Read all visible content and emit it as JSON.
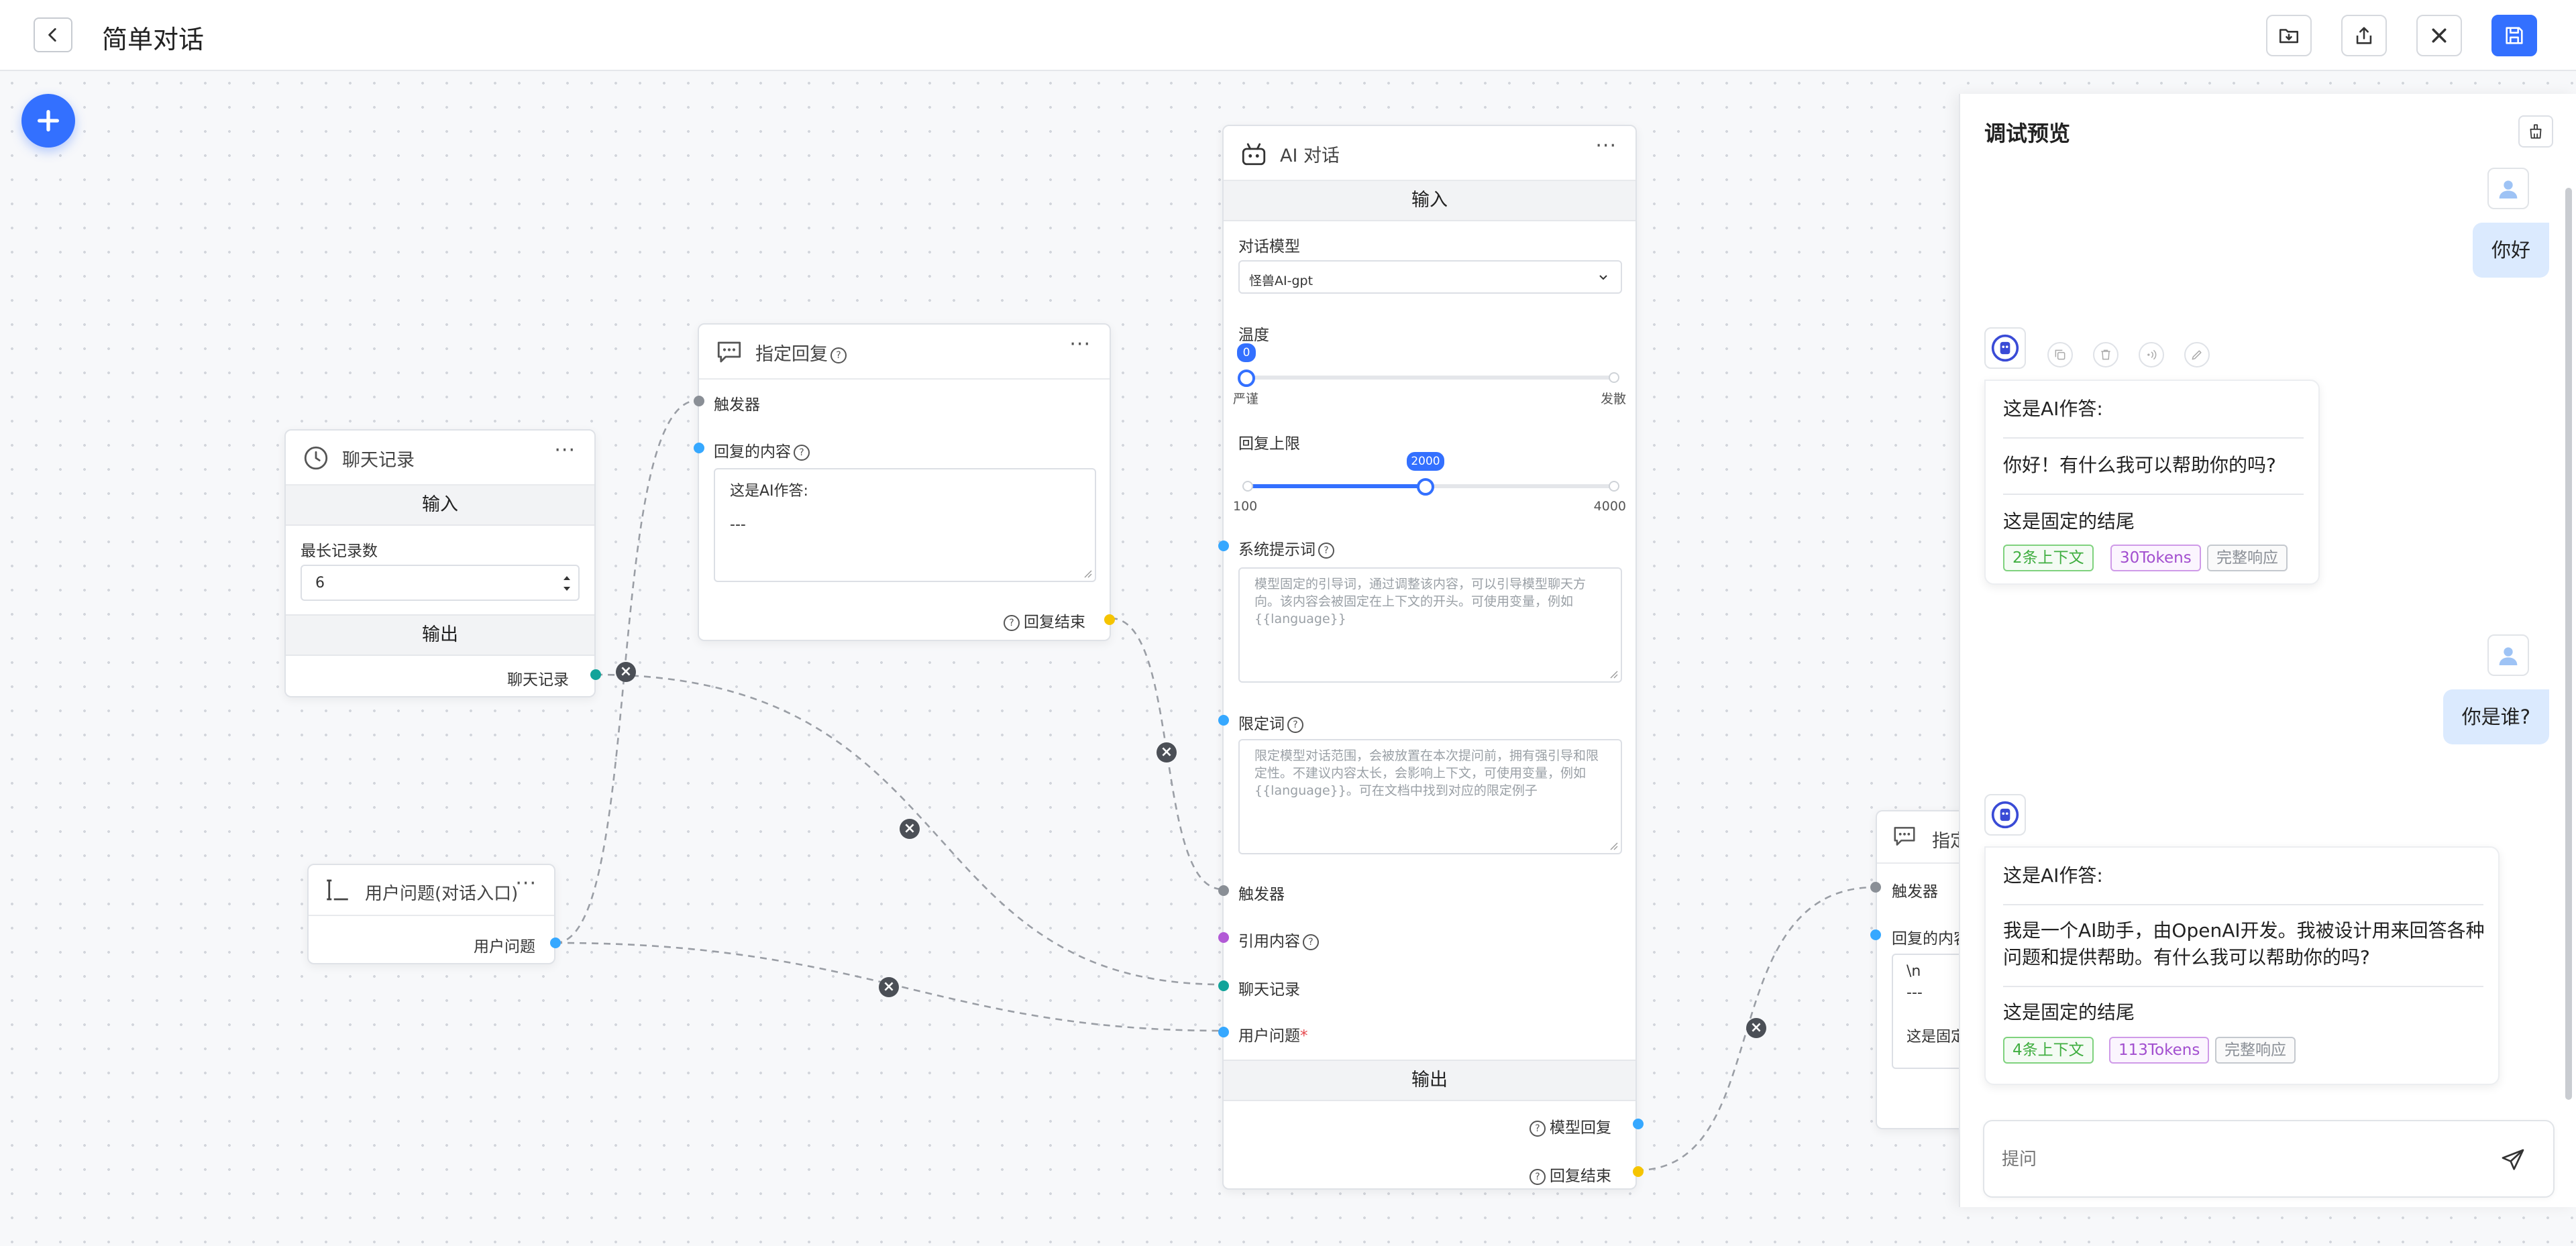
{
  "app": {
    "title": "简单对话"
  },
  "nodes": {
    "history": {
      "title": "聊天记录",
      "input_section": "输入",
      "max_label": "最长记录数",
      "max_value": "6",
      "output_section": "输出",
      "output_label": "聊天记录"
    },
    "user_question": {
      "title": "用户问题(对话入口)",
      "output_label": "用户问题"
    },
    "reply1": {
      "title": "指定回复",
      "trigger_label": "触发器",
      "content_label": "回复的内容",
      "content_line1": "这是AI作答:",
      "content_line2": "---",
      "end_label": "回复结束"
    },
    "ai_chat": {
      "title": "AI 对话",
      "input_section": "输入",
      "model_label": "对话模型",
      "model_value": "怪兽AI-gpt",
      "temp_label": "温度",
      "temp_value": 0,
      "temp_value_text": "0",
      "temp_min_label": "严谨",
      "temp_max_label": "发散",
      "limit_label": "回复上限",
      "limit_value": 2000,
      "limit_value_text": "2000",
      "limit_min": 100,
      "limit_min_text": "100",
      "limit_max": 4000,
      "limit_max_text": "4000",
      "system_label": "系统提示词",
      "system_placeholder": "模型固定的引导词，通过调整该内容，可以引导模型聊天方向。该内容会被固定在上下文的开头。可使用变量，例如 {{language}}",
      "limit_words_label": "限定词",
      "limit_words_placeholder": "限定模型对话范围，会被放置在本次提问前，拥有强引导和限定性。不建议内容太长，会影响上下文，可使用变量，例如 {{language}}。可在文档中找到对应的限定例子",
      "trigger_label": "触发器",
      "quote_label": "引用内容",
      "history_label": "聊天记录",
      "question_label": "用户问题",
      "required_mark": "*",
      "output_section": "输出",
      "model_reply_label": "模型回复",
      "end_label": "回复结束"
    },
    "reply2": {
      "title_partial": "指定",
      "trigger_label": "触发器",
      "content_label_partial": "回复的内容",
      "content_line1": "\\n",
      "content_line2": "---",
      "content_line3_partial": "这是固定"
    }
  },
  "preview": {
    "title": "调试预览",
    "messages": [
      {
        "role": "user",
        "text": "你好"
      },
      {
        "role": "ai",
        "header": "这是AI作答:",
        "body": "你好！有什么我可以帮助你的吗?",
        "footer": "这是固定的结尾",
        "tags": [
          "2条上下文",
          "30Tokens",
          "完整响应"
        ]
      },
      {
        "role": "user",
        "text": "你是谁?"
      },
      {
        "role": "ai",
        "header": "这是AI作答:",
        "body_line1": "我是一个AI助手，由OpenAI开发。我被设计用来回答各种",
        "body_line2": "问题和提供帮助。有什么我可以帮助你的吗?",
        "footer": "这是固定的结尾",
        "tags": [
          "4条上下文",
          "113Tokens",
          "完整响应"
        ]
      }
    ],
    "input_placeholder": "提问"
  },
  "colors": {
    "primary": "#3370ff",
    "handle_blue": "#36a8ff",
    "handle_teal": "#12a39a",
    "handle_purple": "#b25ad6",
    "handle_yellow": "#f5c400",
    "handle_grey": "#8a8f96",
    "user_bubble": "#dbeafe"
  },
  "icons": {
    "back": "chevron-left-icon",
    "import": "folder-import-icon",
    "export": "export-icon",
    "close": "close-icon",
    "save": "save-icon",
    "add": "plus-icon",
    "send": "send-icon"
  }
}
